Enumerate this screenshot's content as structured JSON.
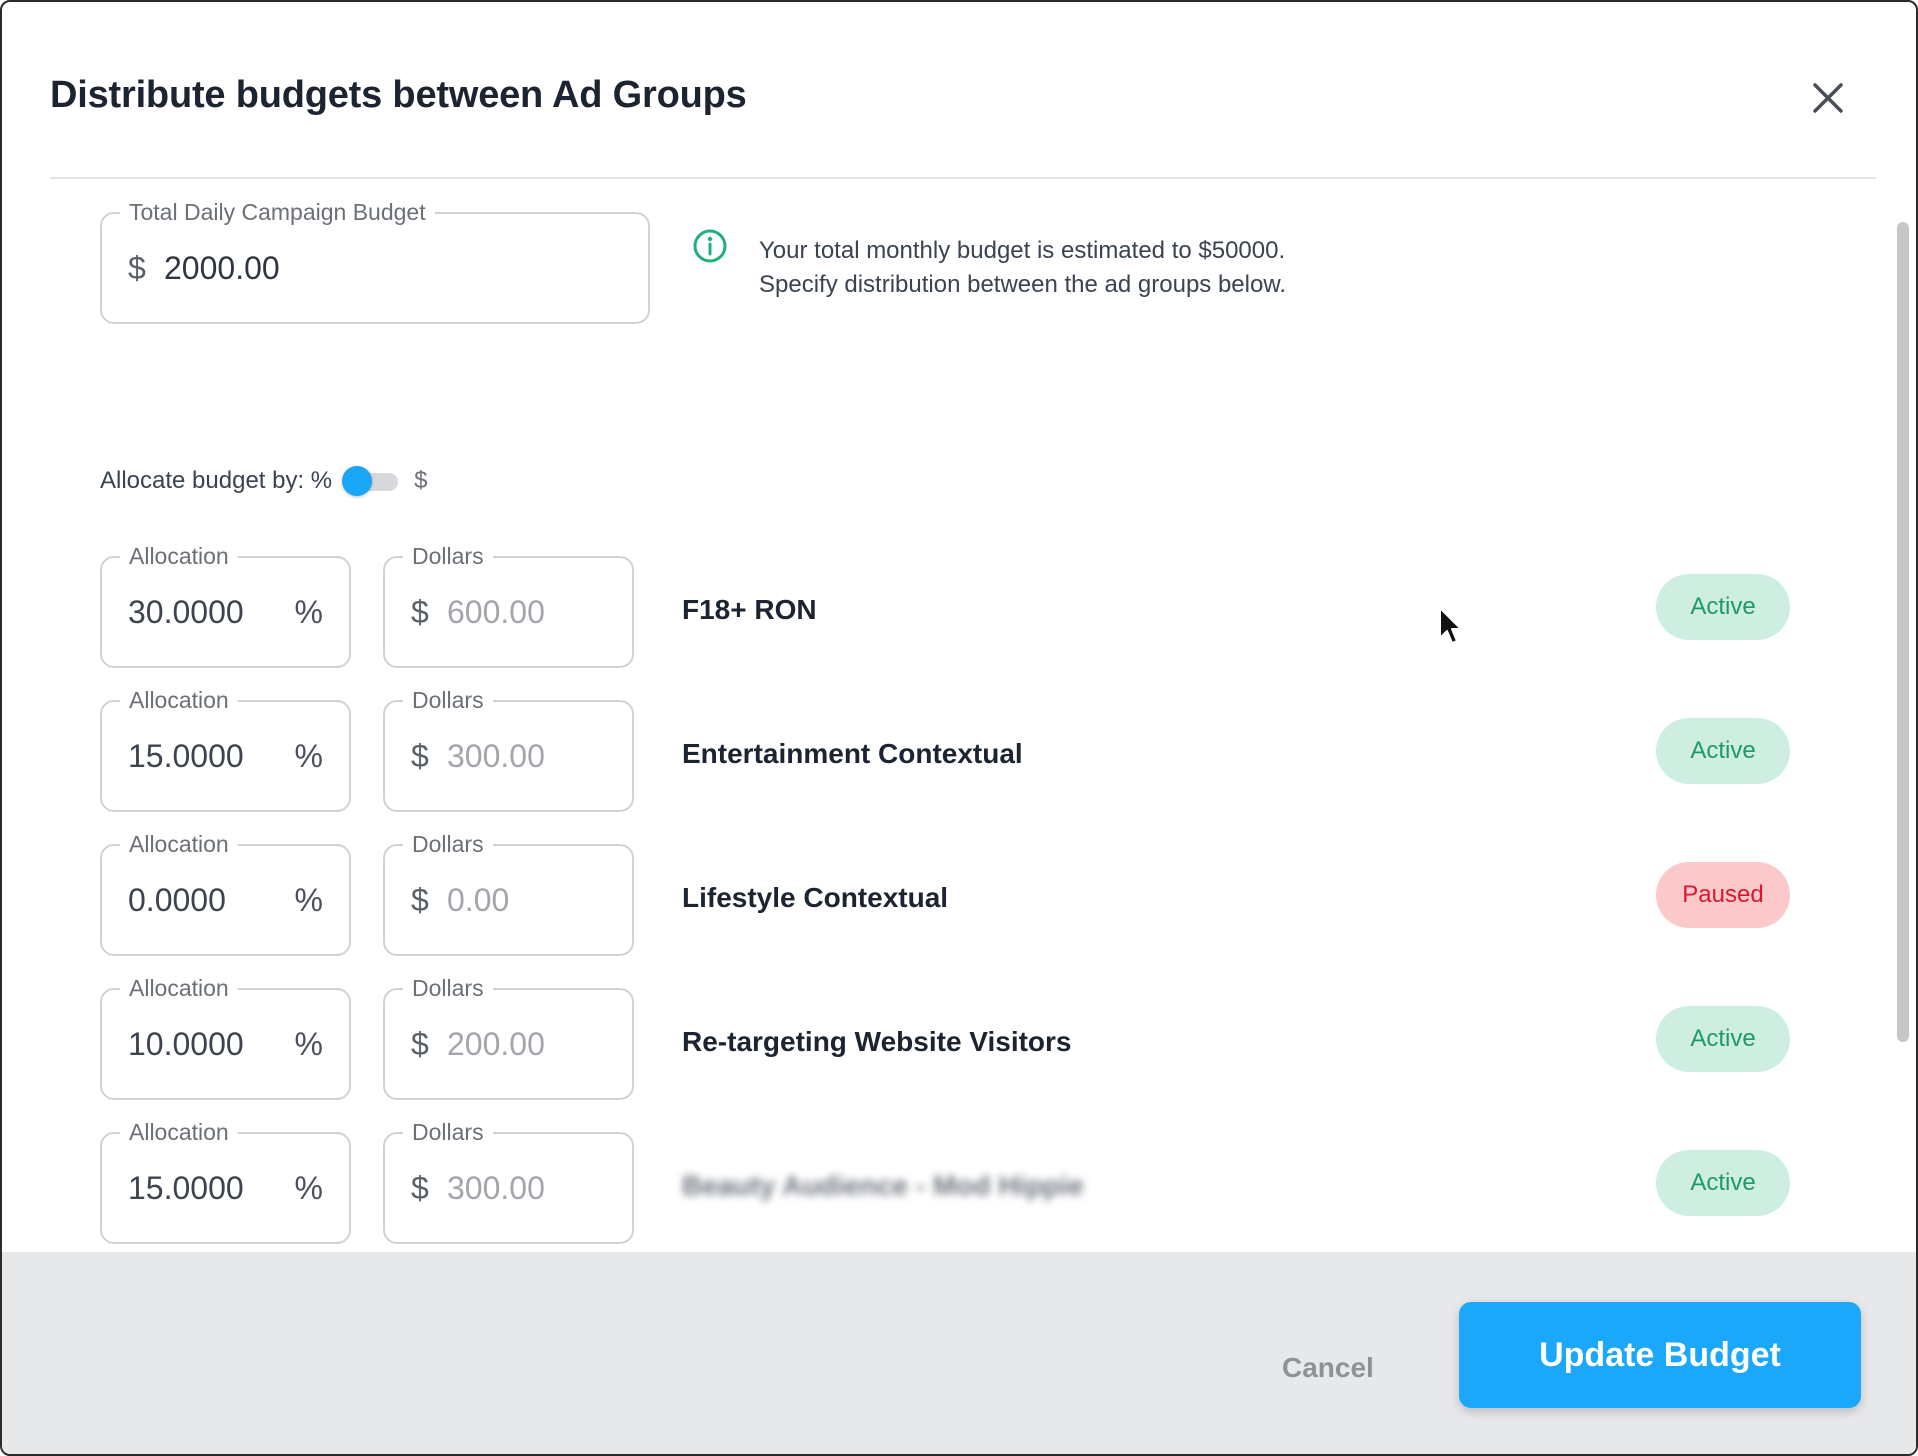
{
  "dialog": {
    "title": "Distribute budgets between Ad Groups"
  },
  "total_budget": {
    "label": "Total Daily Campaign Budget",
    "currency_symbol": "$",
    "value": "2000.00"
  },
  "info": {
    "icon": "info-circle-icon",
    "line1": "Your total monthly budget is estimated to $50000.",
    "line2": "Specify distribution between the ad groups below."
  },
  "allocate_toggle": {
    "label": "Allocate budget by: %",
    "alt_label": "$",
    "selected": "%"
  },
  "field_labels": {
    "allocation": "Allocation",
    "dollars": "Dollars",
    "percent_suffix": "%",
    "currency_symbol": "$"
  },
  "ad_groups": [
    {
      "allocation": "30.0000",
      "dollars": "600.00",
      "name": "F18+ RON",
      "status": "Active"
    },
    {
      "allocation": "15.0000",
      "dollars": "300.00",
      "name": "Entertainment Contextual",
      "status": "Active"
    },
    {
      "allocation": "0.0000",
      "dollars": "0.00",
      "name": "Lifestyle Contextual",
      "status": "Paused"
    },
    {
      "allocation": "10.0000",
      "dollars": "200.00",
      "name": "Re-targeting Website Visitors",
      "status": "Active"
    },
    {
      "allocation": "15.0000",
      "dollars": "300.00",
      "name": "Beauty Audience - Mod Hippie",
      "status": "Active",
      "blurred": true
    }
  ],
  "footer": {
    "cancel_label": "Cancel",
    "update_label": "Update Budget"
  },
  "colors": {
    "accent": "#1ba8fa",
    "active_bg": "#cdeee1",
    "active_text": "#1e9a68",
    "paused_bg": "#fbc9c9",
    "paused_text": "#d8182e",
    "info_icon": "#20b07a"
  }
}
